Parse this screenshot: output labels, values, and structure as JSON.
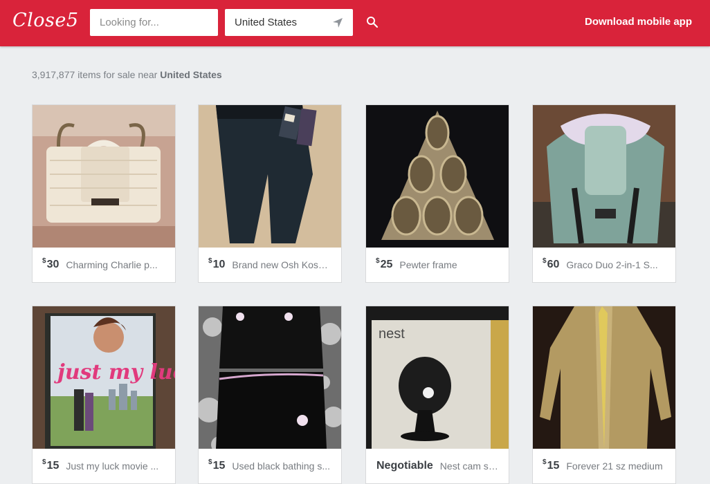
{
  "header": {
    "logo": "Close5",
    "search_placeholder": "Looking for...",
    "location": "United States",
    "download_label": "Download mobile app",
    "brand_color": "#d9233a"
  },
  "results": {
    "count": "3,917,877",
    "text": "items for sale near",
    "location": "United States"
  },
  "listings": [
    {
      "currency": "$",
      "price": "30",
      "title": "Charming Charlie p...",
      "image": "cream-handbag"
    },
    {
      "currency": "$",
      "price": "10",
      "title": "Brand new Osh Kosh...",
      "image": "toddler-jeans"
    },
    {
      "currency": "$",
      "price": "25",
      "title": "Pewter frame",
      "image": "pewter-photo-frame"
    },
    {
      "currency": "$",
      "price": "60",
      "title": "Graco Duo 2-in-1 S...",
      "image": "baby-seat"
    },
    {
      "currency": "$",
      "price": "15",
      "title": "Just my luck movie ...",
      "image": "dvd-case"
    },
    {
      "currency": "$",
      "price": "15",
      "title": "Used black bathing s...",
      "image": "black-swimsuit"
    },
    {
      "currency": "",
      "price": "Negotiable",
      "title": "Nest cam sec...",
      "image": "nest-camera-box"
    },
    {
      "currency": "$",
      "price": "15",
      "title": "Forever 21 sz medium",
      "image": "tan-coat"
    }
  ]
}
